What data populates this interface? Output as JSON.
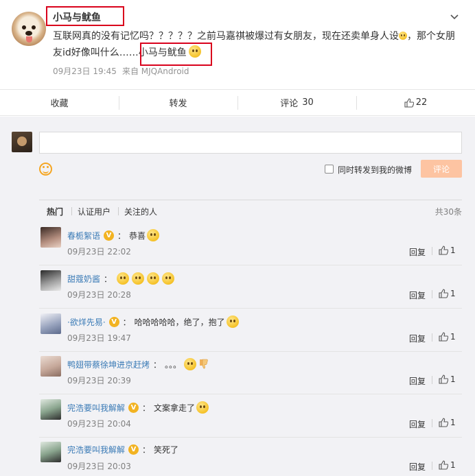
{
  "post": {
    "username": "小马与鱿鱼",
    "text_part1": "互联网真的没有记忆吗？？？？？之前马嘉祺被爆过有女朋友，现在还卖单身人设",
    "text_part2": "，那个女朋友id好像叫什么……",
    "mention": "小马与鱿鱼",
    "time": "09月23日 19:45",
    "source": "来自 MJQAndroid"
  },
  "actions": {
    "favorite": "收藏",
    "repost": "转发",
    "comment": "评论",
    "comment_count": "30",
    "like_count": "22"
  },
  "composer": {
    "repost_option": "同时转发到我的微博",
    "submit": "评论"
  },
  "tabs": {
    "hot": "热门",
    "verified": "认证用户",
    "following": "关注的人",
    "total": "共30条"
  },
  "comments": [
    {
      "name": "春栀絮语",
      "text": "恭喜",
      "time": "09月23日 22:02",
      "reply": "回复",
      "likes": "1"
    },
    {
      "name": "甜蔻奶酱",
      "text": "",
      "time": "09月23日 20:28",
      "reply": "回复",
      "likes": "1"
    },
    {
      "name": "·欲烊先易·",
      "text": "哈哈哈哈哈，绝了，抱了",
      "time": "09月23日 19:47",
      "reply": "回复",
      "likes": "1"
    },
    {
      "name": "鸭翅带蔡徐坤进京赶烤",
      "text": "。。。",
      "time": "09月23日 20:39",
      "reply": "回复",
      "likes": "1"
    },
    {
      "name": "完浩要叫我解解",
      "text": "文案拿走了",
      "time": "09月23日 20:04",
      "reply": "回复",
      "likes": "1"
    },
    {
      "name": "完浩要叫我解解",
      "text": "笑死了",
      "time": "09月23日 20:03",
      "reply": "回复",
      "likes": "1"
    }
  ],
  "comment_colon": "：",
  "colors": {
    "accent": "#eb7350",
    "badge": "#f2b322",
    "highlight_box": "#d9001b"
  }
}
